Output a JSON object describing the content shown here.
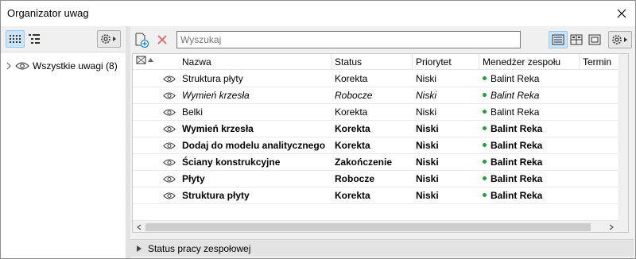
{
  "window": {
    "title": "Organizator uwag"
  },
  "left": {
    "tree_item_label": "Wszystkie uwagi (8)"
  },
  "toolbar": {
    "search_placeholder": "Wyszukaj"
  },
  "table": {
    "headers": [
      "Nazwa",
      "Status",
      "Priorytet",
      "Menedżer zespołu",
      "Termin"
    ],
    "rows": [
      {
        "name": "Struktura płyty",
        "status": "Korekta",
        "priority": "Niski",
        "manager": "Balint Reka",
        "style": "normal"
      },
      {
        "name": "Wymień krzesła",
        "status": "Robocze",
        "priority": "Niski",
        "manager": "Balint Reka",
        "style": "italic"
      },
      {
        "name": "Belki",
        "status": "Korekta",
        "priority": "Niski",
        "manager": "Balint Reka",
        "style": "normal"
      },
      {
        "name": "Wymień krzesła",
        "status": "Korekta",
        "priority": "Niski",
        "manager": "Balint Reka",
        "style": "bold"
      },
      {
        "name": "Dodaj do modelu analitycznego",
        "status": "Korekta",
        "priority": "Niski",
        "manager": "Balint Reka",
        "style": "bold"
      },
      {
        "name": "Ściany konstrukcyjne",
        "status": "Zakończenie",
        "priority": "Niski",
        "manager": "Balint Reka",
        "style": "bold"
      },
      {
        "name": "Płyty",
        "status": "Robocze",
        "priority": "Niski",
        "manager": "Balint Reka",
        "style": "bold"
      },
      {
        "name": "Struktura płyty",
        "status": "Korekta",
        "priority": "Niski",
        "manager": "Balint Reka",
        "style": "bold"
      }
    ]
  },
  "status_panel": {
    "label": "Status pracy zespołowej"
  },
  "colors": {
    "status_dot": "#1fa23a",
    "accent": "#0078d7"
  }
}
